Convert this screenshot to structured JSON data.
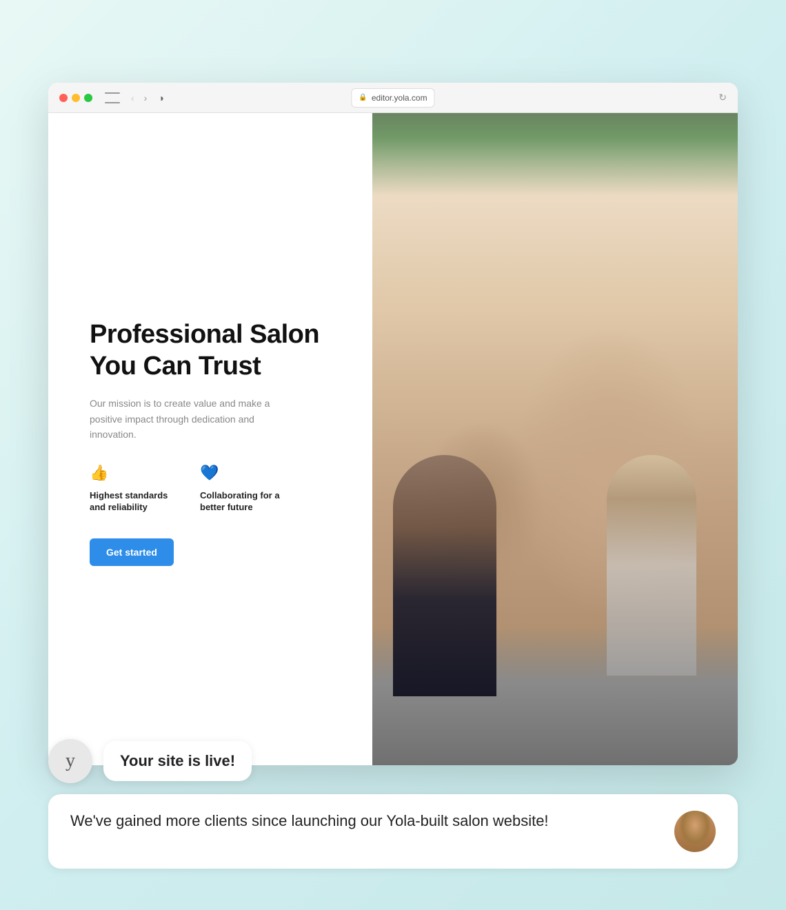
{
  "background": {
    "gradient_start": "#e8f8f5",
    "gradient_end": "#c5e8e8"
  },
  "browser": {
    "url": "editor.yola.com",
    "back_arrow": "‹",
    "forward_arrow": "›",
    "lock_symbol": "🔒",
    "reload_symbol": "↻"
  },
  "hero": {
    "title": "Professional Salon You Can Trust",
    "description": "Our mission is to create value and make a positive impact through dedication and innovation.",
    "features": [
      {
        "icon": "👍",
        "icon_type": "thumbs",
        "label": "Highest standards and reliability"
      },
      {
        "icon": "♥",
        "icon_type": "heart",
        "label": "Collaborating for a better future"
      }
    ],
    "cta_button": "Get started"
  },
  "chat": {
    "yola_letter": "y",
    "notification": "Your site is live!",
    "testimonial": "We've gained more clients since launching our Yola-built salon website!"
  }
}
